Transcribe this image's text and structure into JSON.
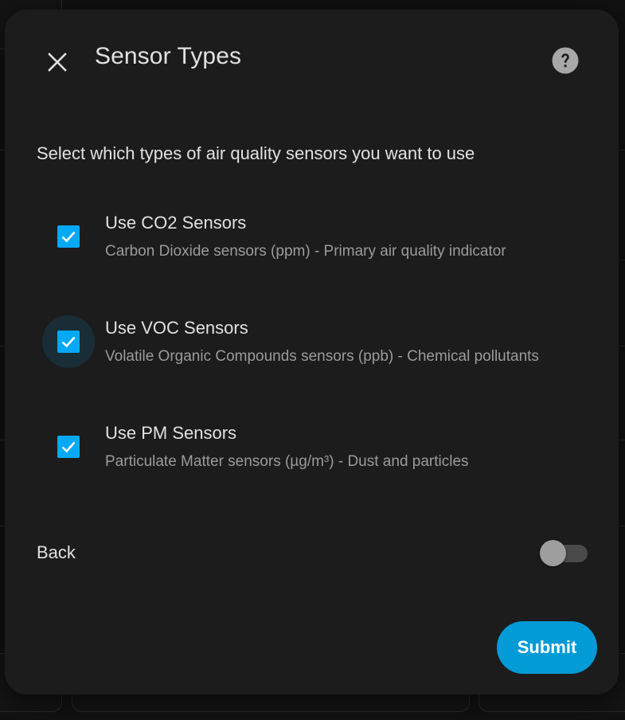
{
  "dialog": {
    "title": "Sensor Types",
    "description": "Select which types of air quality sensors you want to use",
    "options": [
      {
        "label": "Use CO2 Sensors",
        "sublabel": "Carbon Dioxide sensors (ppm) - Primary air quality indicator",
        "checked": true
      },
      {
        "label": "Use VOC Sensors",
        "sublabel": "Volatile Organic Compounds sensors (ppb) - Chemical pollutants",
        "checked": true,
        "focused": true
      },
      {
        "label": "Use PM Sensors",
        "sublabel": "Particulate Matter sensors (µg/m³) - Dust and particles",
        "checked": true
      }
    ],
    "back": {
      "label": "Back",
      "toggle_on": false
    },
    "submit_label": "Submit"
  },
  "icons": {
    "close": "close-icon",
    "help": "help-circle-icon",
    "check": "check-icon"
  },
  "colors": {
    "accent": "#03a9f4",
    "submit": "#039bd6",
    "dialog_bg": "#1c1c1c",
    "text_primary": "#e1e1e1",
    "text_secondary": "#9b9b9b"
  }
}
